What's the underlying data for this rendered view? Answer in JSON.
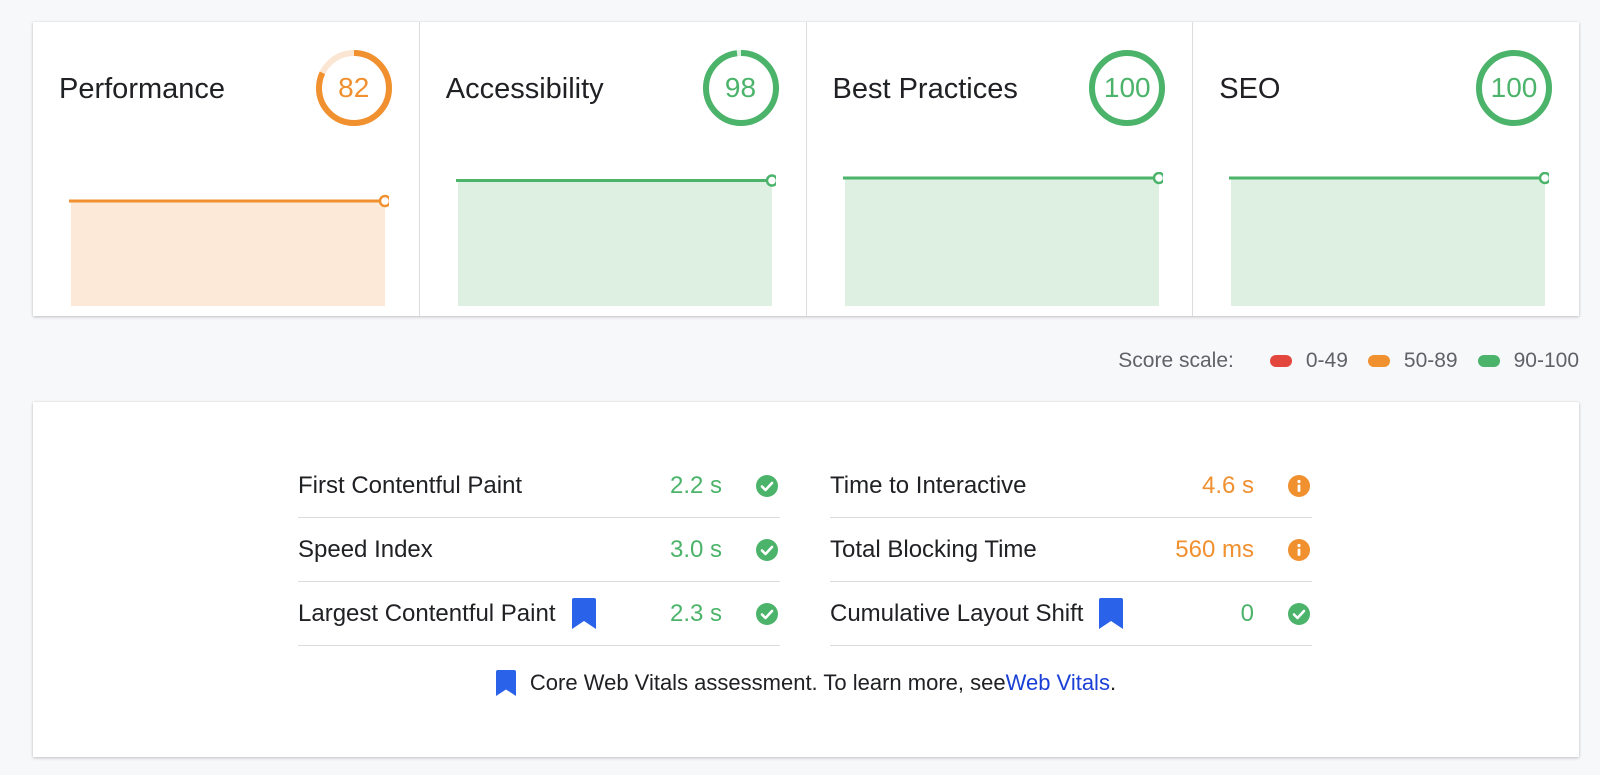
{
  "colors": {
    "fail": "#e2463c",
    "average": "#f0902f",
    "pass": "#4bb36a",
    "average_fill": "#fde9d8",
    "pass_fill": "#ddf0e1",
    "average_track": "#fbe6d3",
    "pass_track": "#e0f2e4",
    "link": "#1a3fd6",
    "bookmark": "#2a62ea"
  },
  "categories": [
    {
      "title": "Performance",
      "score": 82,
      "status": "average",
      "trend_level": 0.82
    },
    {
      "title": "Accessibility",
      "score": 98,
      "status": "pass",
      "trend_level": 0.98
    },
    {
      "title": "Best Practices",
      "score": 100,
      "status": "pass",
      "trend_level": 1.0
    },
    {
      "title": "SEO",
      "score": 100,
      "status": "pass",
      "trend_level": 1.0
    }
  ],
  "score_scale": {
    "label": "Score scale:",
    "ranges": [
      {
        "label": "0-49",
        "status": "fail"
      },
      {
        "label": "50-89",
        "status": "average"
      },
      {
        "label": "90-100",
        "status": "pass"
      }
    ]
  },
  "metrics": {
    "left": [
      {
        "name": "First Contentful Paint",
        "value": "2.2 s",
        "status": "pass",
        "core_web_vital": false,
        "icon": "check-circle-icon"
      },
      {
        "name": "Speed Index",
        "value": "3.0 s",
        "status": "pass",
        "core_web_vital": false,
        "icon": "check-circle-icon"
      },
      {
        "name": "Largest Contentful Paint",
        "value": "2.3 s",
        "status": "pass",
        "core_web_vital": true,
        "icon": "check-circle-icon"
      }
    ],
    "right": [
      {
        "name": "Time to Interactive",
        "value": "4.6 s",
        "status": "average",
        "core_web_vital": false,
        "icon": "info-circle-icon"
      },
      {
        "name": "Total Blocking Time",
        "value": "560 ms",
        "status": "average",
        "core_web_vital": false,
        "icon": "info-circle-icon"
      },
      {
        "name": "Cumulative Layout Shift",
        "value": "0",
        "status": "pass",
        "core_web_vital": true,
        "icon": "check-circle-icon"
      }
    ]
  },
  "vitals_note": {
    "text": "Core Web Vitals assessment. To learn more, see ",
    "link_text": "Web Vitals",
    "suffix": "."
  }
}
